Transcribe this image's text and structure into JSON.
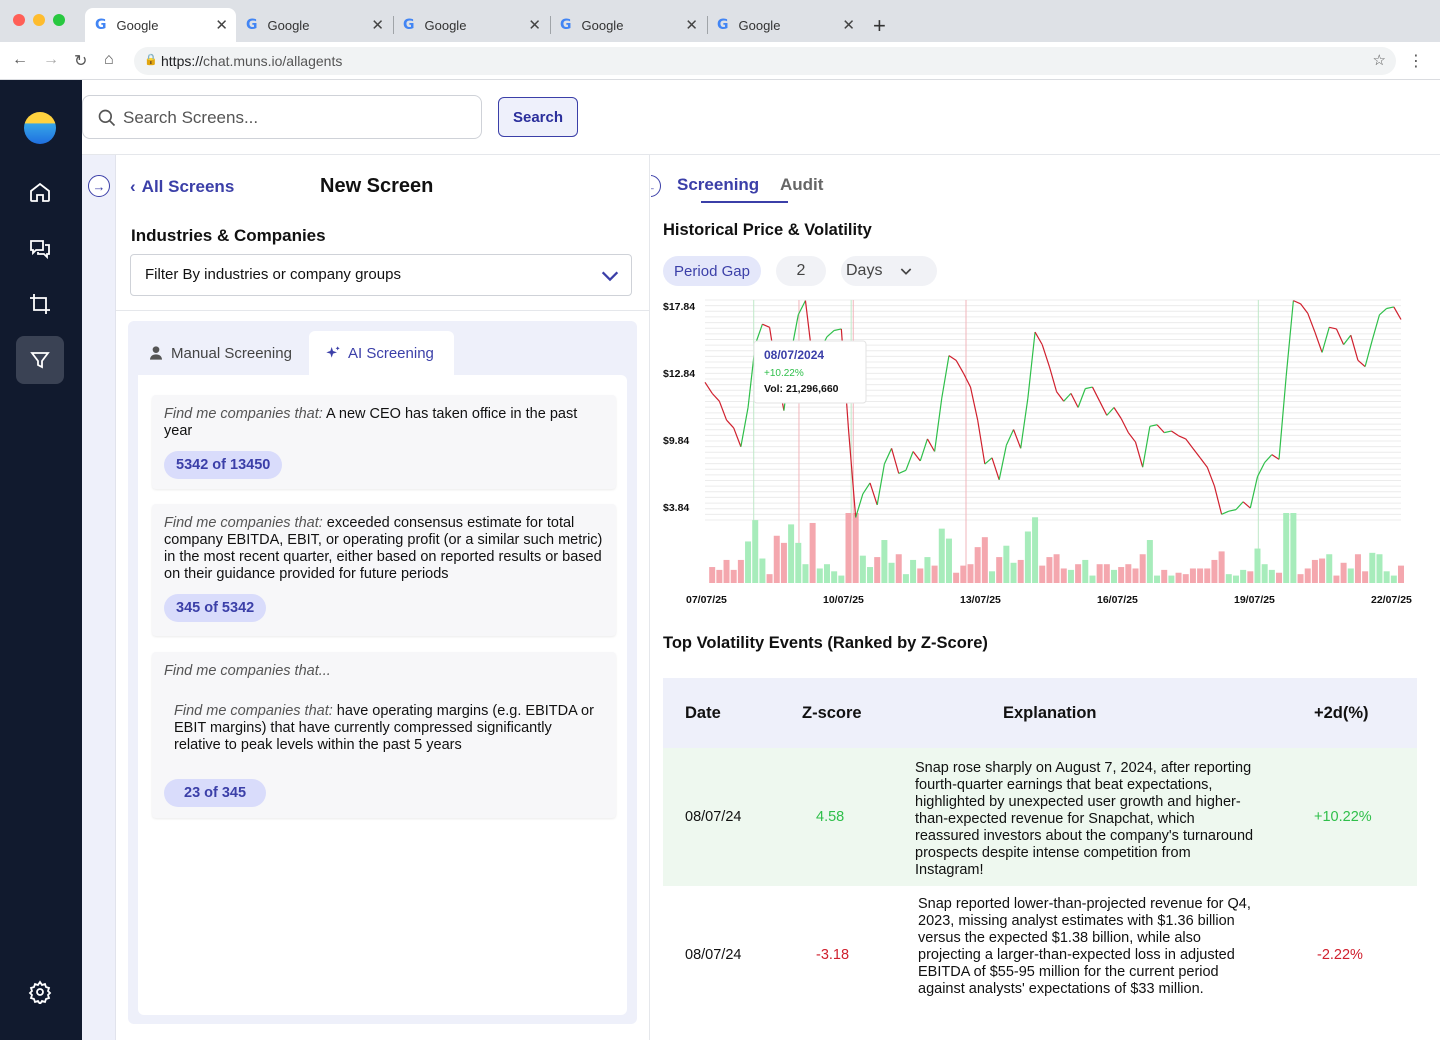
{
  "browser": {
    "tabs": [
      {
        "title": "Google"
      },
      {
        "title": "Google"
      },
      {
        "title": "Google"
      },
      {
        "title": "Google"
      },
      {
        "title": "Google"
      }
    ],
    "url_scheme": "https://",
    "url_rest": "chat.muns.io/allagents"
  },
  "topbar": {
    "search_placeholder": "Search Screens...",
    "search_button": "Search"
  },
  "left": {
    "back_label": "All Screens",
    "title": "New Screen",
    "industries_label": "Industries & Companies",
    "filter_placeholder": "Filter By industries or company groups",
    "tabs": {
      "manual": "Manual Screening",
      "ai": "AI Screening"
    },
    "criteria": [
      {
        "prefix": "Find me companies that:",
        "text": " A new CEO has taken office in the past year",
        "count": "5342 of 13450"
      },
      {
        "prefix": "Find me companies that:",
        "text": " exceeded consensus estimate for total company EBITDA, EBIT, or operating profit (or a similar such metric) in the most recent quarter, either based on reported results or based on their guidance provided for future periods",
        "count": "345 of 5342"
      },
      {
        "prefix": "Find me companies that...",
        "nested_prefix": "Find me companies that:",
        "nested_text": " have operating margins (e.g. EBITDA or EBIT margins) that have currently compressed significantly relative to peak levels within the past 5 years",
        "count": "23 of 345"
      }
    ]
  },
  "right": {
    "tabs": {
      "screening": "Screening",
      "audit": "Audit"
    },
    "chart_title": "Historical Price & Volatility",
    "period_gap_label": "Period Gap",
    "period_gap_value": "2",
    "period_unit": "Days",
    "events_title": "Top Volatility Events (Ranked by Z-Score)",
    "events_headers": {
      "date": "Date",
      "z": "Z-score",
      "explanation": "Explanation",
      "move": "+2d(%)"
    },
    "events": [
      {
        "date": "08/07/24",
        "z": "4.58",
        "explanation": "Snap rose sharply on August 7, 2024, after reporting fourth-quarter earnings that beat expectations, highlighted by unexpected user growth and higher-than-expected revenue for Snapchat, which reassured investors about the company's turnaround prospects despite intense competition from Instagram!",
        "move": "+10.22%"
      },
      {
        "date": "08/07/24",
        "z": "-3.18",
        "explanation": "Snap reported lower-than-projected revenue for Q4, 2023, missing analyst estimates with $1.36 billion versus the expected $1.38 billion, while also projecting a larger-than-expected loss in adjusted EBITDA of $55-95 million for the current period against analysts' expectations of $33 million.",
        "move": "-2.22%"
      }
    ]
  },
  "colors": {
    "accent": "#3b3fa8",
    "up": "#2fbf4a",
    "down": "#d0202e",
    "up_volume": "#a7ecbb",
    "down_volume": "#f4a7ae",
    "rail": "#111a2e"
  },
  "icons": [
    "google-icon",
    "back-arrow-icon",
    "forward-arrow-icon",
    "reload-icon",
    "home-icon",
    "lock-icon",
    "star-icon",
    "menu-dots-icon",
    "app-logo-icon",
    "chat-icon",
    "crop-icon",
    "filter-icon",
    "settings-icon",
    "search-icon",
    "arrow-right-circle-icon",
    "arrow-left-circle-icon",
    "chevron-left-icon",
    "chevron-down-icon",
    "user-icon",
    "sparkles-icon"
  ],
  "chart_data": {
    "type": "line",
    "y_ticks": [
      "$17.84",
      "$12.84",
      "$9.84",
      "$3.84"
    ],
    "x_ticks": [
      "07/07/25",
      "10/07/25",
      "13/07/25",
      "16/07/25",
      "19/07/25",
      "22/07/25"
    ],
    "ylim": [
      3.84,
      17.84
    ],
    "tooltip": {
      "date": "08/07/2024",
      "change": "+10.22%",
      "volume": "Vol: 21,296,660"
    },
    "price": [
      12.6,
      11.9,
      11.4,
      10.2,
      9.7,
      8.5,
      11.0,
      15.0,
      16.3,
      16.1,
      13.2,
      10.8,
      14.5,
      16.9,
      17.8,
      14.0,
      14.6,
      15.5,
      15.9,
      16.0,
      9.6,
      4.0,
      5.5,
      6.2,
      4.8,
      7.4,
      8.4,
      6.8,
      7.0,
      8.2,
      7.6,
      9.0,
      8.2,
      11.6,
      14.3,
      14.0,
      13.2,
      12.3,
      10.2,
      7.4,
      7.8,
      6.4,
      8.6,
      9.6,
      8.4,
      11.6,
      15.8,
      15.0,
      13.6,
      12.0,
      11.4,
      11.9,
      11.0,
      12.2,
      12.3,
      11.4,
      10.5,
      11.0,
      10.3,
      9.4,
      8.8,
      7.2,
      9.8,
      9.9,
      9.4,
      9.5,
      9.2,
      9.0,
      8.4,
      7.8,
      7.2,
      6.0,
      4.2,
      4.4,
      4.5,
      5.0,
      4.6,
      6.6,
      7.5,
      8.0,
      7.7,
      13.0,
      17.8,
      17.6,
      17.0,
      15.8,
      14.5,
      16.1,
      16.0,
      15.0,
      15.6,
      14.0,
      13.6,
      15.3,
      16.9,
      17.3,
      17.4,
      16.6
    ]
  }
}
